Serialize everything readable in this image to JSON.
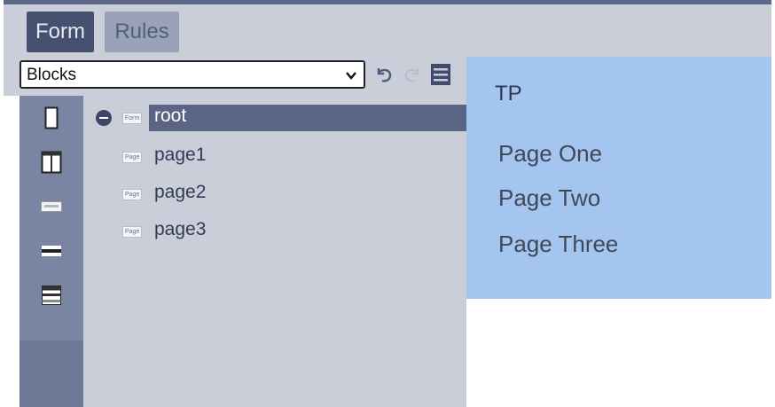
{
  "tabs": [
    {
      "label": "Form",
      "active": true
    },
    {
      "label": "Rules",
      "active": false
    }
  ],
  "toolbar": {
    "select_value": "Blocks",
    "undo_icon": "undo-icon",
    "redo_icon": "redo-icon",
    "menu_icon": "hamburger-menu-icon"
  },
  "palette": [
    "single-column-icon",
    "two-column-icon",
    "page-icon",
    "separator-icon",
    "section-icon"
  ],
  "tree": {
    "root": {
      "tag": "Form",
      "label": "root"
    },
    "children": [
      {
        "tag": "Page",
        "label": "page1"
      },
      {
        "tag": "Page",
        "label": "page2"
      },
      {
        "tag": "Page",
        "label": "page3"
      }
    ]
  },
  "preview": {
    "title": "TP",
    "pages": [
      "Page One",
      "Page Two",
      "Page Three"
    ]
  },
  "colors": {
    "accent": "#455070",
    "tree_bg": "#c9ced9",
    "preview_bg": "#a3c5ef",
    "selection": "#5a6585"
  }
}
